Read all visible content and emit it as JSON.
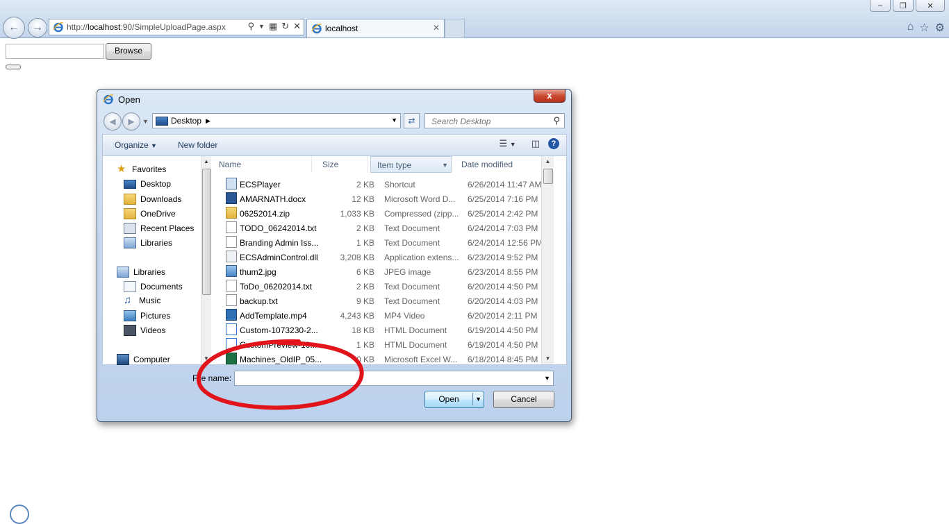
{
  "browser": {
    "address": {
      "prefix": "http://",
      "host": "localhost",
      "rest": ":90/SimpleUploadPage.aspx"
    },
    "tab_title": "localhost",
    "window_buttons": [
      "minimize",
      "restore",
      "close"
    ],
    "right_icons": [
      "home-icon",
      "favorites-star-icon",
      "tools-gear-icon"
    ]
  },
  "page": {
    "browse_label": "Browse"
  },
  "dialog": {
    "title": "Open",
    "close_label": "x",
    "path": "Desktop",
    "search_placeholder": "Search Desktop",
    "toolbar": {
      "organize": "Organize",
      "new_folder": "New folder"
    },
    "nav": {
      "favorites_header": "Favorites",
      "favorites": [
        "Desktop",
        "Downloads",
        "OneDrive",
        "Recent Places",
        "Libraries"
      ],
      "libraries_header": "Libraries",
      "libraries": [
        "Documents",
        "Music",
        "Pictures",
        "Videos"
      ],
      "computer": "Computer"
    },
    "columns": {
      "name": "Name",
      "size": "Size",
      "type": "Item type",
      "date": "Date modified"
    },
    "files": [
      {
        "name": "ECSPlayer",
        "size": "2 KB",
        "type": "Shortcut",
        "date": "6/26/2014 11:47 AM",
        "icon": "shortcut"
      },
      {
        "name": "AMARNATH.docx",
        "size": "12 KB",
        "type": "Microsoft Word D...",
        "date": "6/25/2014 7:16 PM",
        "icon": "word"
      },
      {
        "name": "06252014.zip",
        "size": "1,033 KB",
        "type": "Compressed (zipp...",
        "date": "6/25/2014 2:42 PM",
        "icon": "zip"
      },
      {
        "name": "TODO_06242014.txt",
        "size": "2 KB",
        "type": "Text Document",
        "date": "6/24/2014 7:03 PM",
        "icon": "text"
      },
      {
        "name": "Branding Admin Iss...",
        "size": "1 KB",
        "type": "Text Document",
        "date": "6/24/2014 12:56 PM",
        "icon": "text"
      },
      {
        "name": "ECSAdminControl.dll",
        "size": "3,208 KB",
        "type": "Application extens...",
        "date": "6/23/2014 9:52 PM",
        "icon": "dll"
      },
      {
        "name": "thum2.jpg",
        "size": "6 KB",
        "type": "JPEG image",
        "date": "6/23/2014 8:55 PM",
        "icon": "image"
      },
      {
        "name": "ToDo_06202014.txt",
        "size": "2 KB",
        "type": "Text Document",
        "date": "6/20/2014 4:50 PM",
        "icon": "text"
      },
      {
        "name": "backup.txt",
        "size": "9 KB",
        "type": "Text Document",
        "date": "6/20/2014 4:03 PM",
        "icon": "text"
      },
      {
        "name": "AddTemplate.mp4",
        "size": "4,243 KB",
        "type": "MP4 Video",
        "date": "6/20/2014 2:11 PM",
        "icon": "video"
      },
      {
        "name": "Custom-1073230-2...",
        "size": "18 KB",
        "type": "HTML Document",
        "date": "6/19/2014 4:50 PM",
        "icon": "html"
      },
      {
        "name": "CustomPreview-10...",
        "size": "1 KB",
        "type": "HTML Document",
        "date": "6/19/2014 4:50 PM",
        "icon": "html"
      },
      {
        "name": "Machines_OldIP_05...",
        "size": "0 KB",
        "type": "Microsoft Excel W...",
        "date": "6/18/2014 8:45 PM",
        "icon": "excel"
      }
    ],
    "file_name_label": "File name:",
    "file_name_value": "",
    "open_label": "Open",
    "cancel_label": "Cancel",
    "annotation_color": "#e0141a"
  }
}
